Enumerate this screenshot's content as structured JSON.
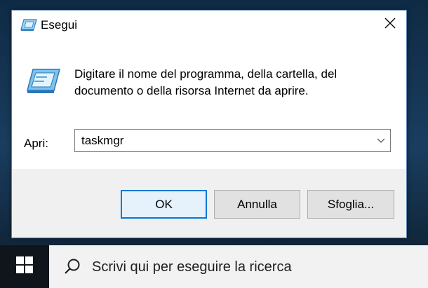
{
  "window": {
    "title": "Esegui",
    "description": "Digitare il nome del programma, della cartella, del documento o della risorsa Internet da aprire.",
    "open_label": "Apri:",
    "open_value": "taskmgr",
    "ok_label": "OK",
    "cancel_label": "Annulla",
    "browse_label": "Sfoglia..."
  },
  "taskbar": {
    "search_placeholder": "Scrivi qui per eseguire la ricerca"
  },
  "icons": {
    "title": "run-icon",
    "close": "close-icon",
    "dialog": "run-icon",
    "dropdown": "chevron-down-icon",
    "start": "windows-logo-icon",
    "search": "search-icon"
  },
  "colors": {
    "accent": "#0078d7",
    "footer_bg": "#f0f0f0",
    "taskbar_bg": "#10151c"
  }
}
